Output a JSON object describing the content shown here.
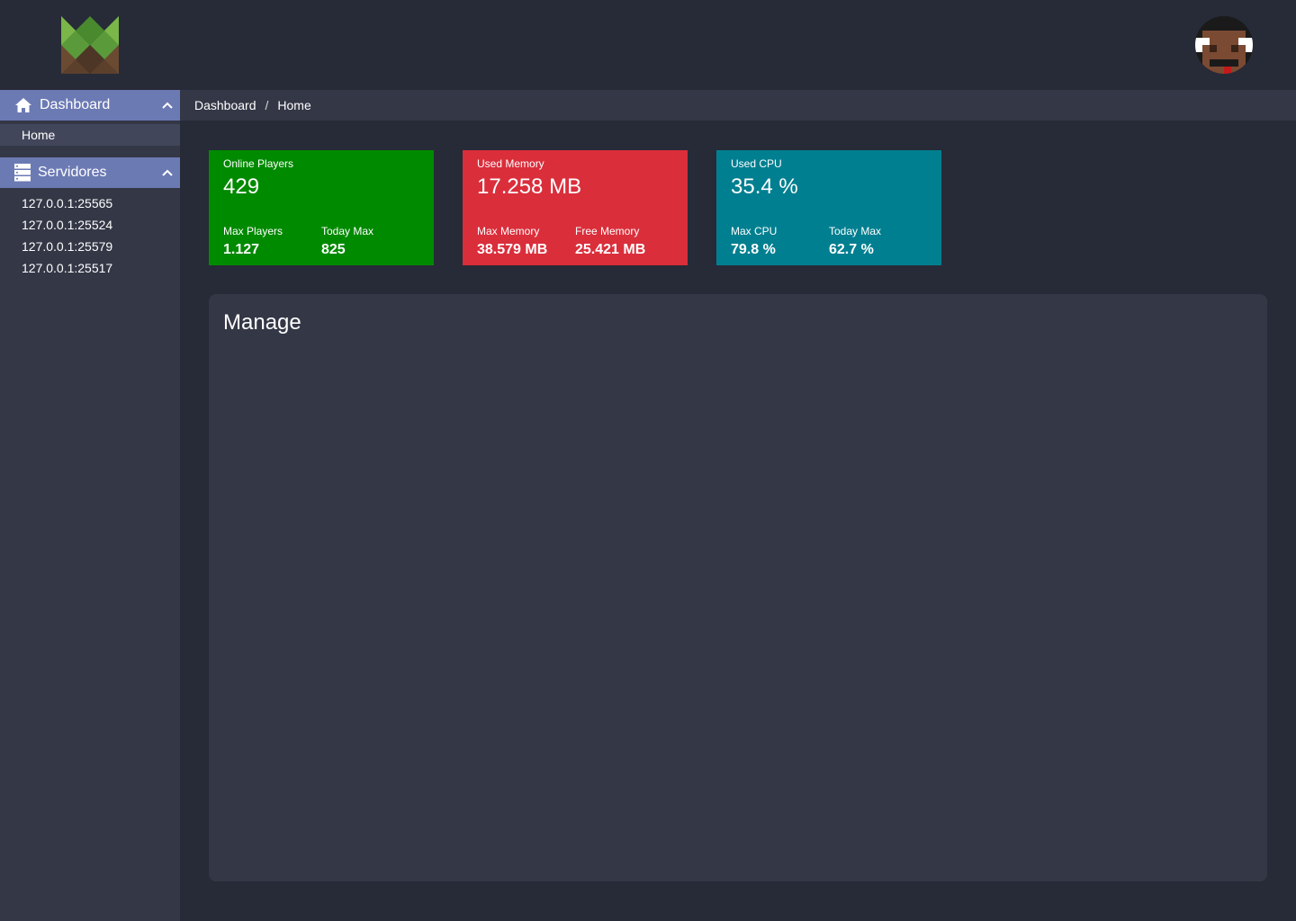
{
  "header": {
    "logo_icon": "m-logo-icon",
    "avatar_icon": "player-avatar-icon"
  },
  "sidebar": {
    "dashboard": {
      "label": "Dashboard",
      "icon": "home-icon",
      "items": [
        {
          "label": "Home"
        }
      ]
    },
    "servers": {
      "label": "Servidores",
      "icon": "server-icon",
      "items": [
        {
          "label": "127.0.0.1:25565"
        },
        {
          "label": "127.0.0.1:25524"
        },
        {
          "label": "127.0.0.1:25579"
        },
        {
          "label": "127.0.0.1:25517"
        }
      ]
    }
  },
  "breadcrumb": {
    "root": "Dashboard",
    "separator": "/",
    "current": "Home"
  },
  "cards": {
    "players": {
      "color": "#008a00",
      "title": "Online Players",
      "value": "429",
      "sub1_label": "Max Players",
      "sub1_value": "1.127",
      "sub2_label": "Today Max",
      "sub2_value": "825"
    },
    "memory": {
      "color": "#da2e3b",
      "title": "Used Memory",
      "value": "17.258 MB",
      "sub1_label": "Max Memory",
      "sub1_value": "38.579 MB",
      "sub2_label": "Free Memory",
      "sub2_value": "25.421 MB"
    },
    "cpu": {
      "color": "#007f90",
      "title": "Used CPU",
      "value": "35.4 %",
      "sub1_label": "Max CPU",
      "sub1_value": "79.8 %",
      "sub2_label": "Today Max",
      "sub2_value": "62.7 %"
    }
  },
  "manage": {
    "title": "Manage"
  },
  "colors": {
    "background": "#272a37",
    "panel": "#343746",
    "sidebar_header": "#6c7ab4"
  }
}
